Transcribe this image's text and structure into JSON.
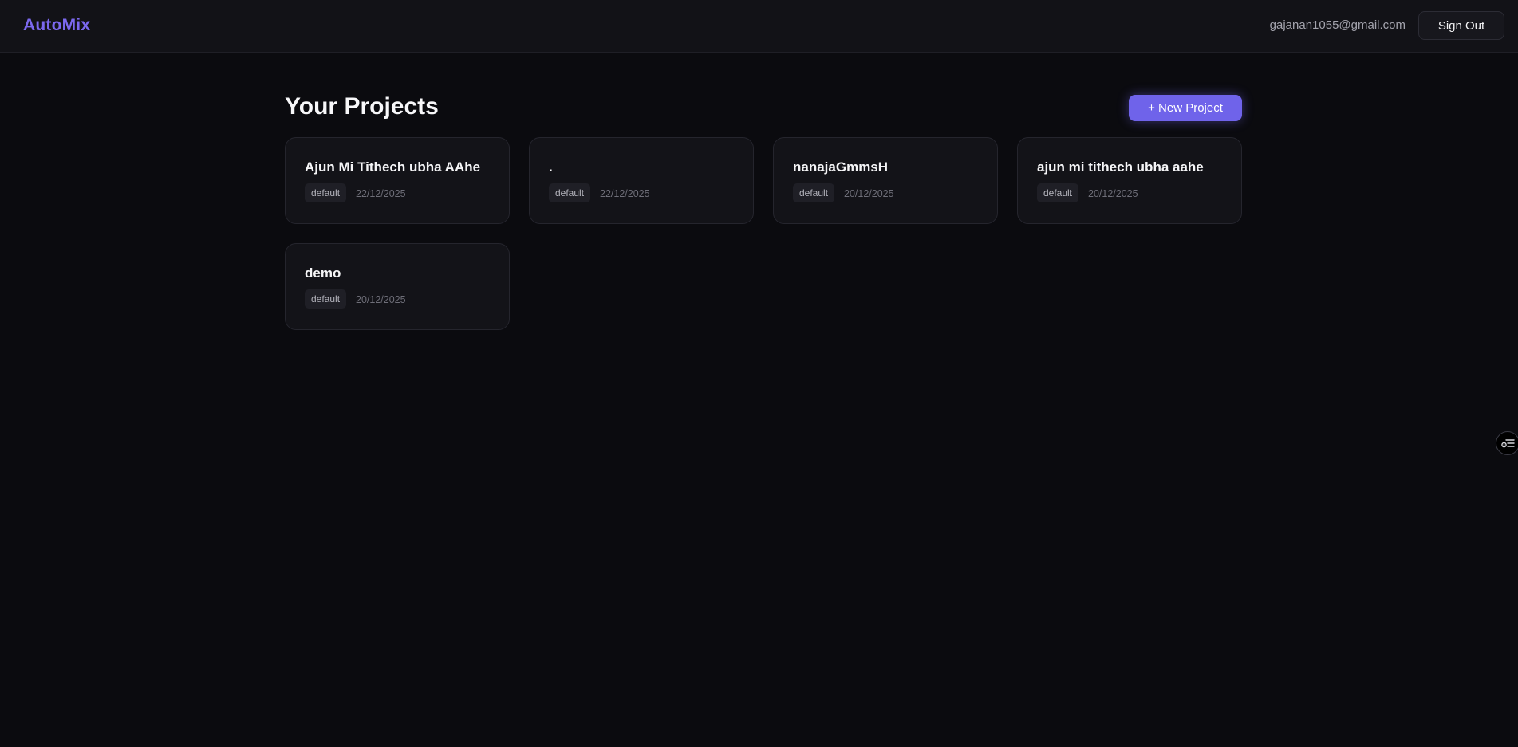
{
  "header": {
    "brand": "AutoMix",
    "user_email": "gajanan1055@gmail.com",
    "sign_out_label": "Sign Out"
  },
  "main": {
    "title": "Your Projects",
    "new_project_label": "+ New Project",
    "projects": [
      {
        "name": "Ajun Mi Tithech ubha AAhe",
        "tag": "default",
        "date": "22/12/2025"
      },
      {
        "name": ".",
        "tag": "default",
        "date": "22/12/2025"
      },
      {
        "name": "nanajaGmmsH",
        "tag": "default",
        "date": "20/12/2025"
      },
      {
        "name": "ajun mi tithech ubha aahe",
        "tag": "default",
        "date": "20/12/2025"
      },
      {
        "name": "demo",
        "tag": "default",
        "date": "20/12/2025"
      }
    ]
  },
  "colors": {
    "accent": "#7b68ee",
    "button_primary": "#6f63ea",
    "background": "#0b0b0f",
    "card": "#131318"
  },
  "icons": {
    "side_widget": "settings-list-icon"
  }
}
